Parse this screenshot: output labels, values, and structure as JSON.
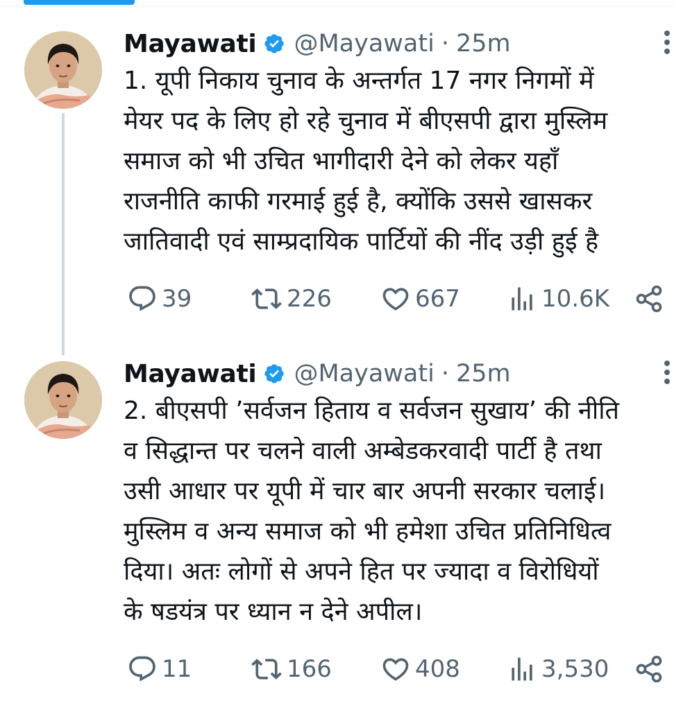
{
  "tweets": [
    {
      "author": {
        "name": "Mayawati",
        "handle": "@Mayawati",
        "time": "25m"
      },
      "text_lines": [
        "1. यूपी निकाय चुनाव के अन्तर्गत 17 नगर निगमों में",
        "मेयर पद के लिए हो रहे चुनाव में बीएसपी द्वारा मुस्लिम",
        "समाज को भी उचित भागीदारी देने को लेकर यहाँ",
        "राजनीति काफी गरमाई हुई है, क्योंकि उससे खासकर",
        "जातिवादी एवं साम्प्रदायिक पार्टियों की नींद उड़ी हुई है"
      ],
      "stats": {
        "replies": "39",
        "retweets": "226",
        "likes": "667",
        "views": "10.6K"
      }
    },
    {
      "author": {
        "name": "Mayawati",
        "handle": "@Mayawati",
        "time": "25m"
      },
      "text_lines": [
        "2. बीएसपी ’सर्वजन हिताय व सर्वजन सुखाय’ की नीति",
        "व सिद्धान्त पर चलने वाली अम्बेडकरवादी पार्टी है तथा",
        "उसी आधार पर यूपी में चार बार अपनी सरकार चलाई।",
        "मुस्लिम व अन्य समाज को भी हमेशा उचित प्रतिनिधित्व",
        "दिया। अतः लोगों से अपने हित पर ज्यादा व विरोधियों",
        "के षडयंत्र पर ध्यान न देने अपील।"
      ],
      "stats": {
        "replies": "11",
        "retweets": "166",
        "likes": "408",
        "views": "3,530"
      }
    }
  ],
  "icons": {
    "verified": "verified-badge-icon",
    "more": "more-options-icon",
    "reply": "reply-icon",
    "retweet": "retweet-icon",
    "like": "like-icon",
    "views": "views-icon",
    "share": "share-icon"
  },
  "colors": {
    "accent": "#1d9bf0",
    "text": "#0f1419",
    "secondary": "#536471",
    "thread_line": "#cfd9de"
  }
}
